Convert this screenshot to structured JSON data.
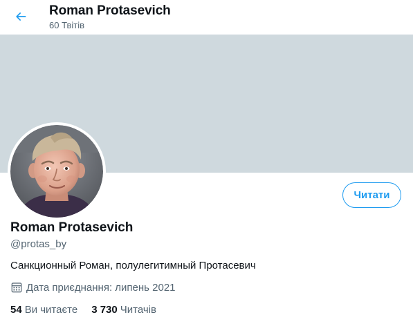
{
  "header": {
    "title": "Roman Protasevich",
    "tweet_count": "60 Твітів"
  },
  "profile": {
    "name": "Roman Protasevich",
    "handle": "@protas_by",
    "bio": "Санкционный Роман, полулегитимный Протасевич",
    "joined": "Дата приєднання: липень 2021",
    "follow_label": "Читати",
    "following_count": "54",
    "following_label": "Ви читаєте",
    "followers_count": "3 730",
    "followers_label": "Читачів"
  },
  "colors": {
    "accent": "#1d9bf0",
    "banner": "#cfd9de",
    "text_primary": "#0f1419",
    "text_secondary": "#536471"
  },
  "icons": {
    "back": "arrow-left-icon",
    "calendar": "calendar-icon"
  }
}
